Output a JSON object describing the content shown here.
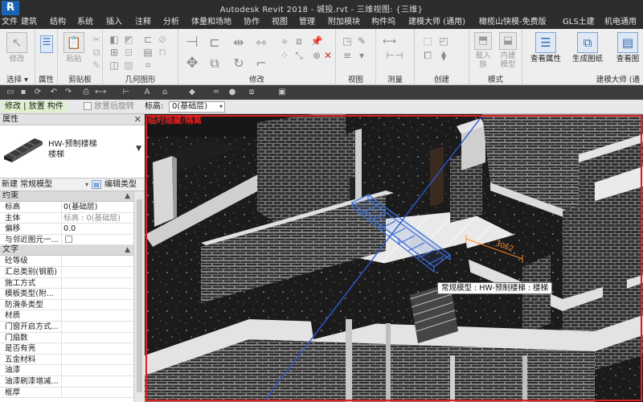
{
  "titlebar": {
    "app_icon": "revit-logo-icon",
    "back_glyph": "←",
    "title": "Autodesk Revit 2018 -    城投.rvt - 三维视图: {三维}"
  },
  "menu": {
    "tabs": [
      "文件",
      "建筑",
      "结构",
      "系统",
      "插入",
      "注释",
      "分析",
      "体量和场地",
      "协作",
      "视图",
      "管理",
      "附加模块",
      "构件坞",
      "建模大师 (通用)",
      "橄榄山快模-免费版",
      "GLS土建",
      "机电通用"
    ]
  },
  "ribbon": {
    "panels": {
      "select": "选择 ▾",
      "properties": "属性",
      "clipboard": "剪贴板",
      "geometry": "几何图形",
      "modify": "修改",
      "view": "视图",
      "measure": "测量",
      "create": "创建",
      "mode": "模式",
      "modeling_master": "建模大师 (通"
    },
    "buttons": {
      "modify": "修改",
      "paste": "粘贴",
      "load_family": "载入\n族",
      "in_place_model": "内建\n模型",
      "view_properties": "查看属性",
      "generate_drawing": "生成图纸",
      "view_drawing": "查看图"
    }
  },
  "options_bar": {
    "context": "修改 | 放置 构件",
    "rotate_after_place": "放置后旋转",
    "level_label": "标高:",
    "level_value": "0(基础层)"
  },
  "properties": {
    "header": "属性",
    "close_glyph": "✕",
    "family": "HW-预制楼梯",
    "type": "楼梯",
    "instance_filter": "新建 常规模型",
    "edit_type": "编辑类型",
    "groups": [
      {
        "name": "约束",
        "rows": [
          {
            "k": "标高",
            "v": "0(基础层)",
            "dim": false
          },
          {
            "k": "主体",
            "v": "标高 : 0(基础层)",
            "dim": true
          },
          {
            "k": "偏移",
            "v": "0.0",
            "dim": false
          },
          {
            "k": "与邻近图元一...",
            "v": "",
            "dim": false,
            "checkbox": true
          }
        ]
      },
      {
        "name": "文字",
        "rows": [
          {
            "k": "砼等级",
            "v": ""
          },
          {
            "k": "汇总类别(钢筋)",
            "v": ""
          },
          {
            "k": "施工方式",
            "v": ""
          },
          {
            "k": "模板类型(附...",
            "v": ""
          },
          {
            "k": "防滑条类型",
            "v": ""
          },
          {
            "k": "材质",
            "v": ""
          },
          {
            "k": "门窗开启方式...",
            "v": ""
          },
          {
            "k": "门扇数",
            "v": ""
          },
          {
            "k": "是否有亮",
            "v": ""
          },
          {
            "k": "五金材料",
            "v": ""
          },
          {
            "k": "油漆",
            "v": ""
          },
          {
            "k": "油漆刷漆增减...",
            "v": ""
          },
          {
            "k": "框厚",
            "v": ""
          }
        ]
      }
    ]
  },
  "viewport": {
    "temp_hide_label": "临时隐藏/隔离",
    "tooltip": "常规模型 : HW-预制楼梯 : 楼梯",
    "dimension_text": "3062",
    "colors": {
      "frame": "#e02020",
      "selection": "#3d6fd6",
      "brick": "#2f2f2f",
      "mortar": "#9a9a9a",
      "top_surface": "#d5d5d5"
    }
  }
}
